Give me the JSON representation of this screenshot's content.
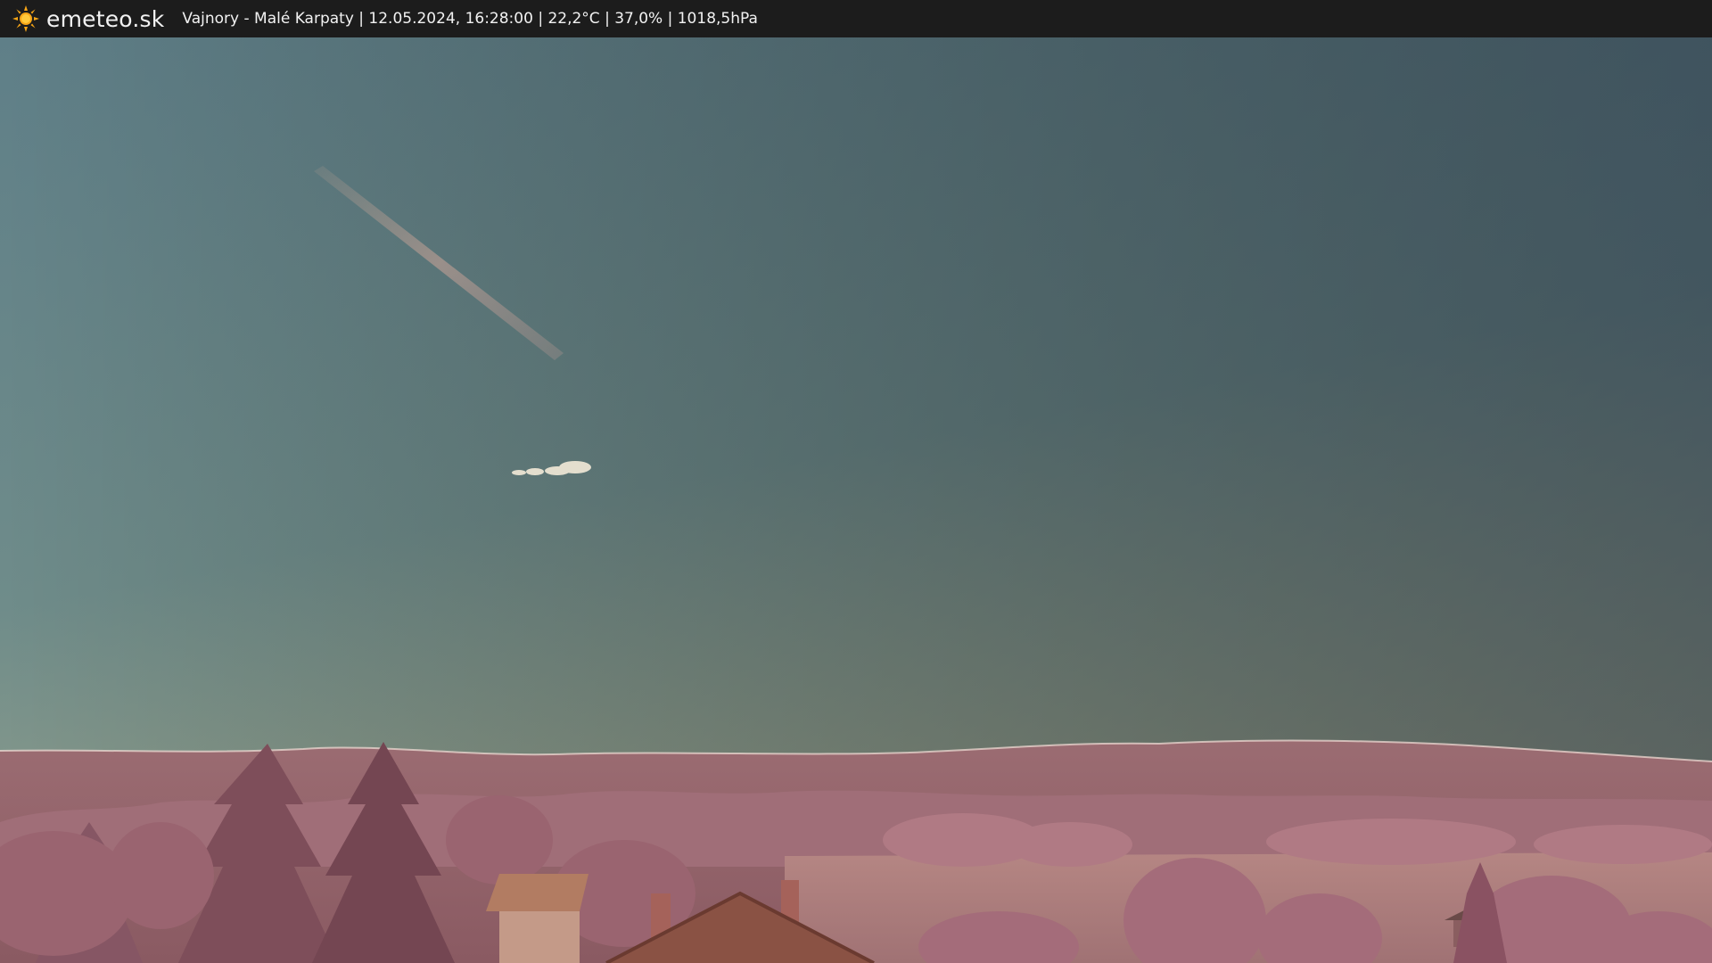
{
  "header": {
    "brand": "emeteo.sk",
    "caption": "Vajnory - Malé Karpaty | 12.05.2024, 16:28:00 | 22,2°C | 37,0% | 1018,5hPa",
    "logo_icon": "sun-icon",
    "background": "#1c1c1c",
    "text_color": "#f2f2f2"
  },
  "scene": {
    "sky_top": "#3a4858",
    "sky_bottom": "#9aa38a",
    "hills": "#9a6a70",
    "foliage": "#a8707a",
    "field": "#b88a88"
  }
}
